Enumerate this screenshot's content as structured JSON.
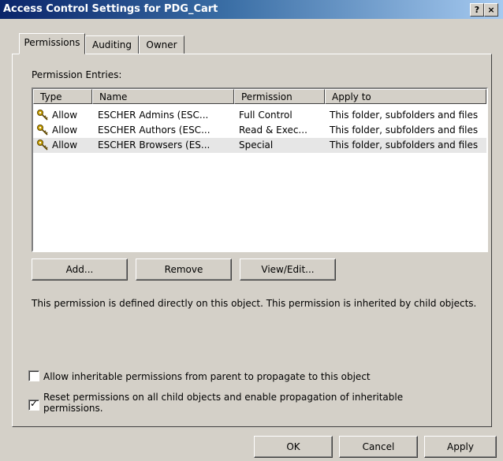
{
  "window": {
    "title": "Access Control Settings for PDG_Cart",
    "help_button": "?",
    "close_button": "×"
  },
  "tabs": [
    {
      "label": "Permissions",
      "active": true
    },
    {
      "label": "Auditing",
      "active": false
    },
    {
      "label": "Owner",
      "active": false
    }
  ],
  "permissions": {
    "entries_label": "Permission Entries:",
    "columns": [
      "Type",
      "Name",
      "Permission",
      "Apply to"
    ],
    "rows": [
      {
        "type": "Allow",
        "name": "ESCHER Admins (ESC...",
        "permission": "Full Control",
        "apply_to": "This folder, subfolders and files",
        "selected": false
      },
      {
        "type": "Allow",
        "name": "ESCHER Authors (ESC...",
        "permission": "Read & Exec...",
        "apply_to": "This folder, subfolders and files",
        "selected": false
      },
      {
        "type": "Allow",
        "name": "ESCHER Browsers (ES...",
        "permission": "Special",
        "apply_to": "This folder, subfolders and files",
        "selected": true
      }
    ],
    "buttons": {
      "add": "Add...",
      "remove": "Remove",
      "view_edit": "View/Edit..."
    },
    "description": "This permission is defined directly on this object. This permission is inherited by child objects.",
    "options": [
      {
        "label": "Allow inheritable permissions from parent to propagate to this object",
        "checked": false
      },
      {
        "label": "Reset permissions on all child objects and enable propagation of inheritable permissions.",
        "checked": true
      }
    ]
  },
  "footer": {
    "ok": "OK",
    "cancel": "Cancel",
    "apply": "Apply"
  },
  "colors": {
    "dialog_face": "#d4d0c8",
    "title_start": "#0a246a",
    "title_end": "#a6caf0",
    "selected_row": "#e6e6e6"
  }
}
